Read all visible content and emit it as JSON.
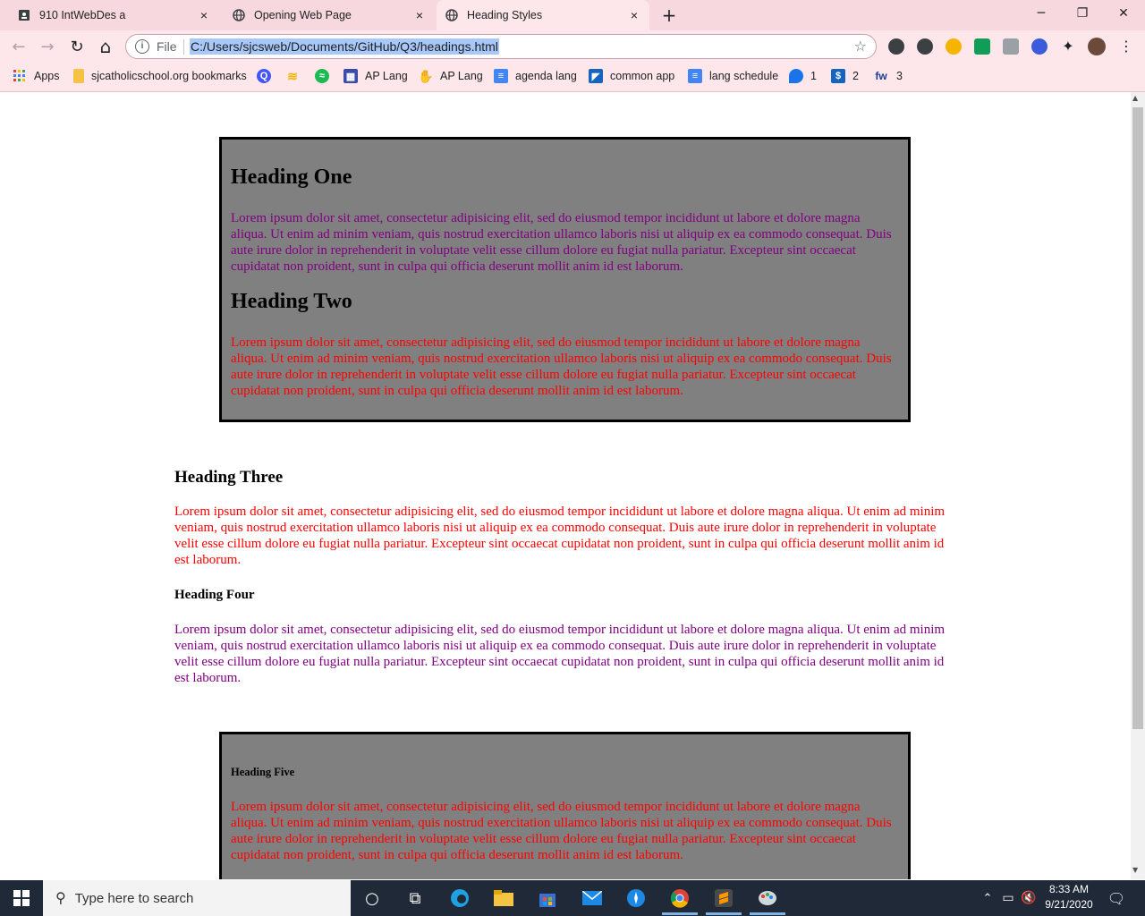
{
  "tabs": [
    {
      "title": "910 IntWebDes a",
      "close": "×"
    },
    {
      "title": "Opening Web Page",
      "close": "×"
    },
    {
      "title": "Heading Styles",
      "close": "×"
    }
  ],
  "new_tab": "+",
  "window_controls": {
    "minimize": "─",
    "restore": "❐",
    "close": "✕"
  },
  "nav": {
    "back": "←",
    "forward": "→",
    "reload": "↻",
    "home": "⌂"
  },
  "omnibox": {
    "scheme_label": "File",
    "url": "C:/Users/sjcsweb/Documents/GitHub/Q3/headings.html"
  },
  "bookmarks": [
    {
      "label": "Apps",
      "icon": "apps-grid-icon"
    },
    {
      "label": "sjcatholicschool.org bookmarks",
      "icon": "folder-icon"
    },
    {
      "label": "",
      "icon": "quizlet-icon"
    },
    {
      "label": "",
      "icon": "layers-icon"
    },
    {
      "label": "",
      "icon": "spotify-icon"
    },
    {
      "label": "AP Lang",
      "icon": "board-icon"
    },
    {
      "label": "AP Lang",
      "icon": "hand-icon"
    },
    {
      "label": "agenda lang",
      "icon": "docs-icon"
    },
    {
      "label": "common app",
      "icon": "app-icon"
    },
    {
      "label": "lang schedule",
      "icon": "docs-icon"
    },
    {
      "label": "1",
      "icon": "chat-icon"
    },
    {
      "label": "2",
      "icon": "dollar-icon"
    },
    {
      "label": "3",
      "icon": "fw-icon"
    }
  ],
  "page": {
    "heading_one": "Heading One",
    "heading_two": "Heading Two",
    "heading_three": "Heading Three",
    "heading_four": "Heading Four",
    "heading_five": "Heading Five",
    "lorem": "Lorem ipsum dolor sit amet, consectetur adipisicing elit, sed do eiusmod tempor incididunt ut labore et dolore magna aliqua. Ut enim ad minim veniam, quis nostrud exercitation ullamco laboris nisi ut aliquip ex ea commodo consequat. Duis aute irure dolor in reprehenderit in voluptate velit esse cillum dolore eu fugiat nulla pariatur. Excepteur sint occaecat cupidatat non proident, sunt in culpa qui officia deserunt mollit anim id est laborum."
  },
  "colors": {
    "purple_text": "#800080",
    "red_text": "#ff0000",
    "box_bg": "#808080",
    "tab_strip": "#f6d8de"
  },
  "taskbar": {
    "search_placeholder": "Type here to search",
    "time": "8:33 AM",
    "date": "9/21/2020"
  }
}
